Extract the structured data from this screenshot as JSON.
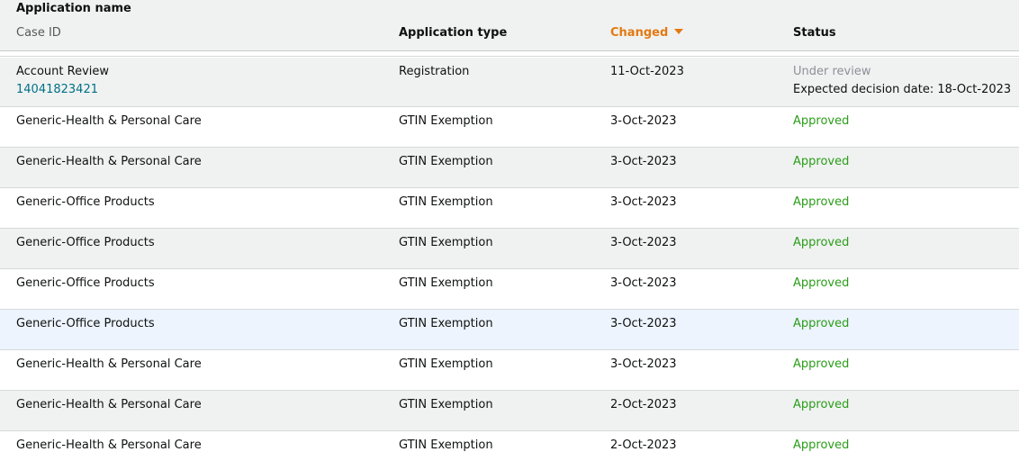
{
  "header": {
    "application_name": "Application name",
    "case_id": "Case ID",
    "application_type": "Application type",
    "changed": "Changed",
    "status": "Status"
  },
  "rows": [
    {
      "name": "Account Review",
      "case_id": "14041823421",
      "type": "Registration",
      "changed": "11-Oct-2023",
      "status": "Under review",
      "expected": "Expected decision date: 18-Oct-2023"
    },
    {
      "name": "Generic-Health & Personal Care",
      "type": "GTIN Exemption",
      "changed": "3-Oct-2023",
      "status": "Approved"
    },
    {
      "name": "Generic-Health & Personal Care",
      "type": "GTIN Exemption",
      "changed": "3-Oct-2023",
      "status": "Approved"
    },
    {
      "name": "Generic-Office Products",
      "type": "GTIN Exemption",
      "changed": "3-Oct-2023",
      "status": "Approved"
    },
    {
      "name": "Generic-Office Products",
      "type": "GTIN Exemption",
      "changed": "3-Oct-2023",
      "status": "Approved"
    },
    {
      "name": "Generic-Office Products",
      "type": "GTIN Exemption",
      "changed": "3-Oct-2023",
      "status": "Approved"
    },
    {
      "name": "Generic-Office Products",
      "type": "GTIN Exemption",
      "changed": "3-Oct-2023",
      "status": "Approved"
    },
    {
      "name": "Generic-Health & Personal Care",
      "type": "GTIN Exemption",
      "changed": "3-Oct-2023",
      "status": "Approved"
    },
    {
      "name": "Generic-Health & Personal Care",
      "type": "GTIN Exemption",
      "changed": "2-Oct-2023",
      "status": "Approved"
    },
    {
      "name": "Generic-Health & Personal Care",
      "type": "GTIN Exemption",
      "changed": "2-Oct-2023",
      "status": "Approved"
    }
  ],
  "colors": {
    "sort_accent": "#e47911",
    "approved": "#2a9d18",
    "link": "#007185",
    "muted": "#8d9096"
  },
  "icons": {
    "sort": "caret-down-icon"
  }
}
